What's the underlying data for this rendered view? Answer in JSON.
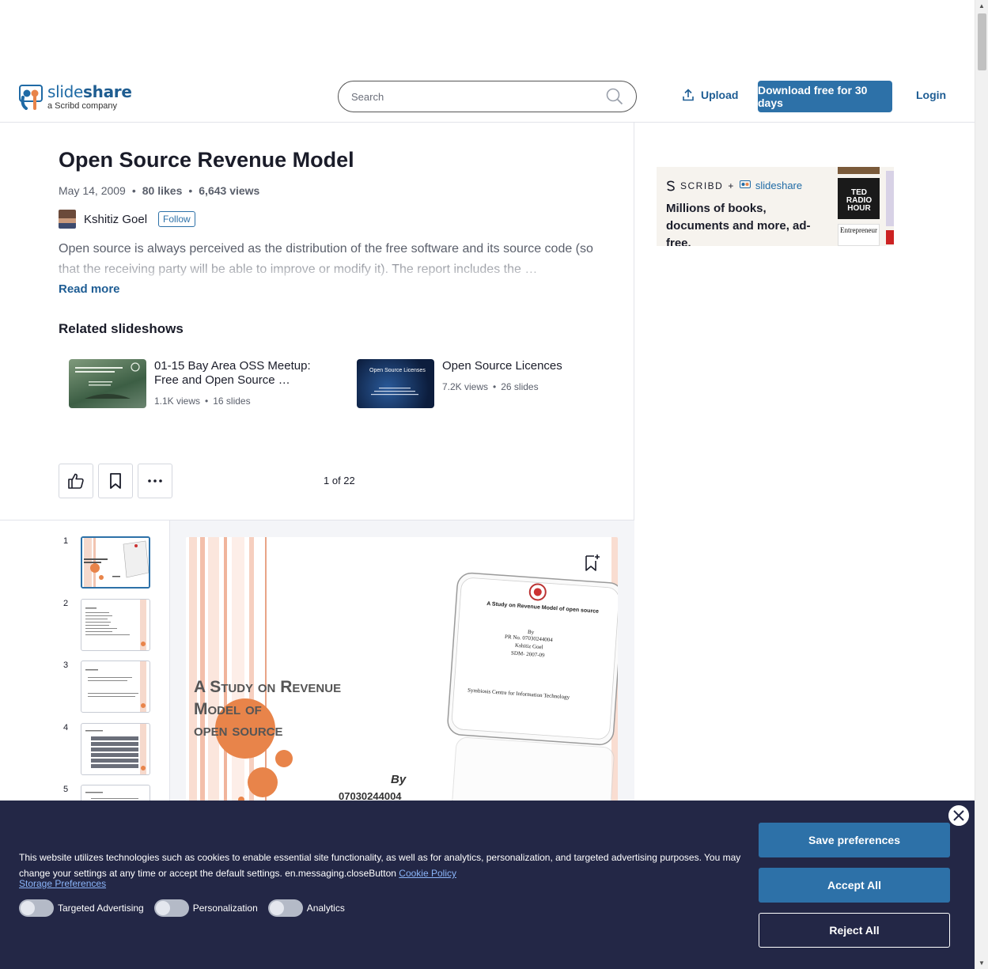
{
  "header": {
    "logo_name": "slide",
    "logo_name_bold": "share",
    "logo_sub": "a Scribd company",
    "search_placeholder": "Search",
    "upload_label": "Upload",
    "download_label": "Download free for 30 days",
    "login_label": "Login"
  },
  "doc": {
    "title": "Open Source Revenue Model",
    "date": "May 14, 2009",
    "likes": "80 likes",
    "views": "6,643 views",
    "author": "Kshitiz Goel",
    "follow_label": "Follow",
    "description": "Open source is always perceived as the distribution of the free software and its source code (so that the receiving party will be able to improve or modify it). The report includes the …",
    "read_more": "Read more"
  },
  "related": {
    "title": "Related slideshows",
    "items": [
      {
        "title": "01-15 Bay Area OSS Meetup: Free and Open Source …",
        "views": "1.1K views",
        "slides": "16 slides"
      },
      {
        "title": "Open Source Licences",
        "views": "7.2K views",
        "slides": "26 slides",
        "thumb_text": "Open Source Licenses"
      }
    ]
  },
  "viewer": {
    "page_count": "1 of 22",
    "thumbs": [
      "1",
      "2",
      "3",
      "4",
      "5"
    ],
    "slide": {
      "title_line1": "A Study on Revenue",
      "title_line2": "Model of",
      "title_line3": "open source",
      "by": "By",
      "number": "07030244004",
      "report_title": "A Study on Revenue Model of open source",
      "report_by": "By",
      "report_prn": "PR No. 07030244004",
      "report_name": "Kshitiz Goel",
      "report_batch": "SDM- 2007-09",
      "report_inst": "Symbiosis Centre for Information Technology"
    }
  },
  "ad": {
    "brand1": "SCRIBD",
    "plus": "+",
    "brand2": "slideshare",
    "text": "Millions of books, documents and more, ad-free.",
    "book1": "TED RADIO HOUR",
    "book2": "Entrepreneur"
  },
  "cookie": {
    "text": "This website utilizes technologies such as cookies to enable essential site functionality, as well as for analytics, personalization, and targeted advertising purposes. You may change your settings at any time or accept the default settings. en.messaging.closeButton",
    "policy_link": "Cookie Policy",
    "storage_link": "Storage Preferences",
    "toggles": [
      "Targeted Advertising",
      "Personalization",
      "Analytics"
    ],
    "save_label": "Save preferences",
    "accept_label": "Accept All",
    "reject_label": "Reject All"
  },
  "colors": {
    "brand_blue": "#2d71a8",
    "cookie_bg": "#232746",
    "slide_orange": "#e8844a"
  }
}
